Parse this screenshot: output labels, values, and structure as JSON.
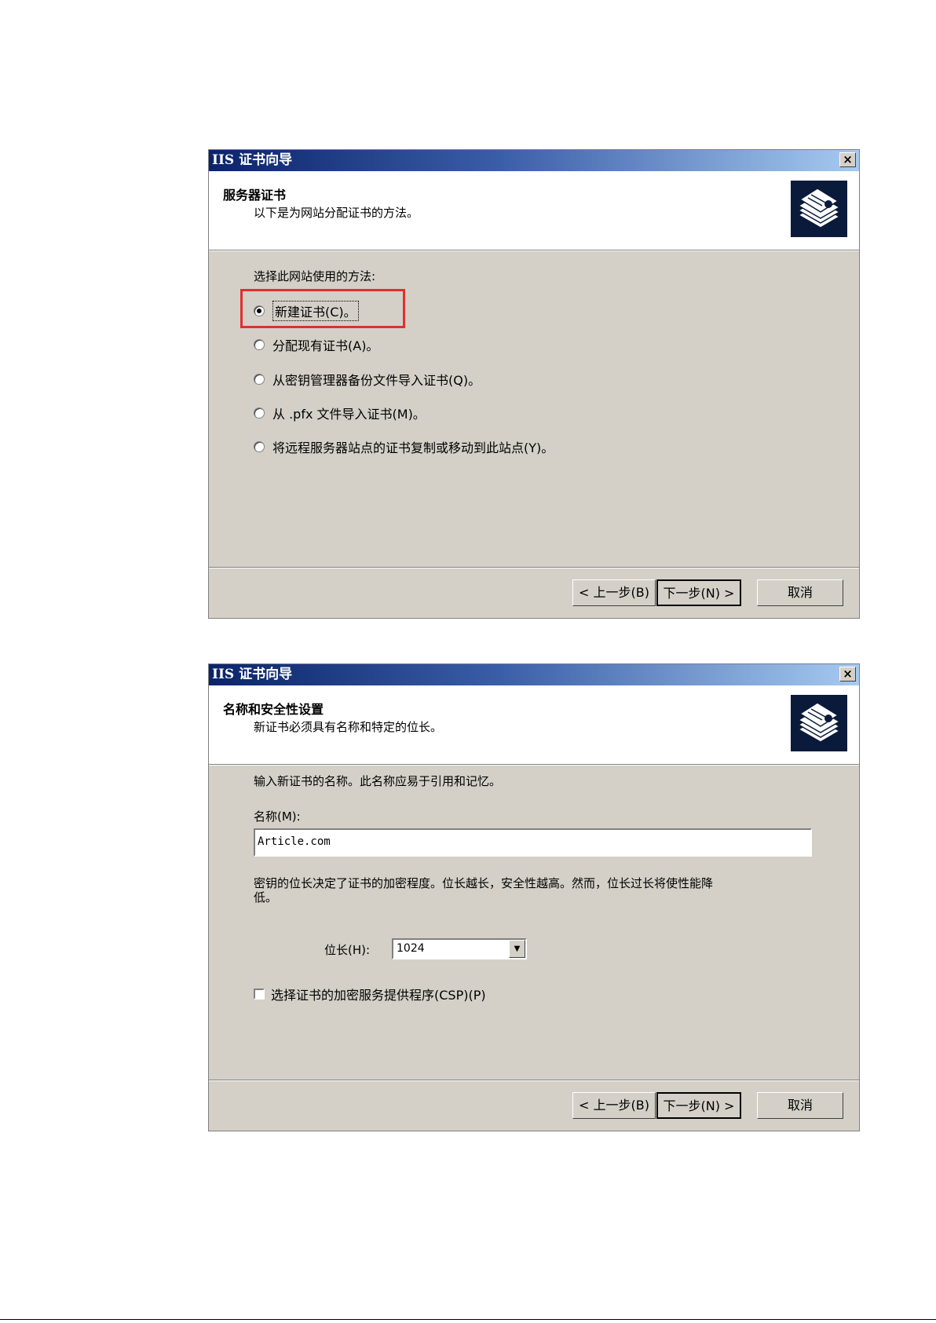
{
  "dialog1": {
    "title": "IIS 证书向导",
    "close": "×",
    "header_title": "服务器证书",
    "header_subtitle": "以下是为网站分配证书的方法。",
    "prompt": "选择此网站使用的方法:",
    "options": [
      {
        "label": "新建证书(C)。",
        "selected": true
      },
      {
        "label": "分配现有证书(A)。",
        "selected": false
      },
      {
        "label": "从密钥管理器备份文件导入证书(Q)。",
        "selected": false
      },
      {
        "label": "从 .pfx 文件导入证书(M)。",
        "selected": false
      },
      {
        "label": "将远程服务器站点的证书复制或移动到此站点(Y)。",
        "selected": false
      }
    ],
    "buttons": {
      "back": "< 上一步(B)",
      "next": "下一步(N) >",
      "cancel": "取消"
    }
  },
  "dialog2": {
    "title": "IIS 证书向导",
    "close": "×",
    "header_title": "名称和安全性设置",
    "header_subtitle": "新证书必须具有名称和特定的位长。",
    "intro": "输入新证书的名称。此名称应易于引用和记忆。",
    "name_label": "名称(M):",
    "name_value": "Article.com",
    "bitlength_desc_line1": "密钥的位长决定了证书的加密程度。位长越长，安全性越高。然而，位长过长将使性能降",
    "bitlength_desc_line2": "低。",
    "bitlength_label": "位长(H):",
    "bitlength_value": "1024",
    "csp_label": "选择证书的加密服务提供程序(CSP)(P)",
    "buttons": {
      "back": "< 上一步(B)",
      "next": "下一步(N) >",
      "cancel": "取消"
    }
  },
  "icons": {
    "header_icon": "certificate-stack-icon",
    "dropdown": "chevron-down-icon"
  }
}
